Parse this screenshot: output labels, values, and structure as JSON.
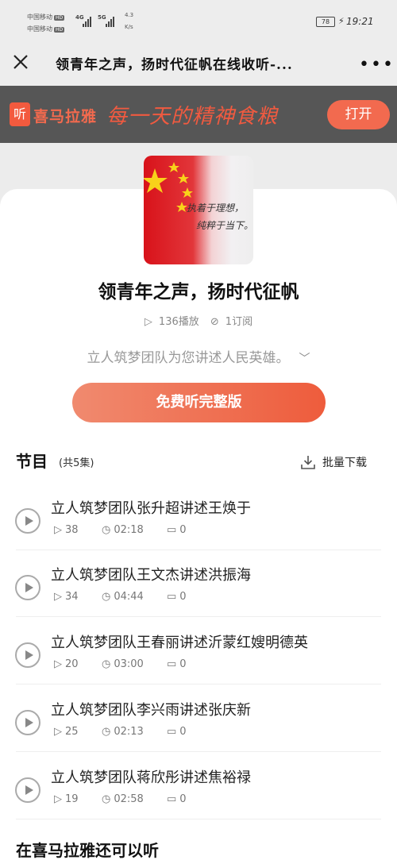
{
  "status_bar": {
    "carrier1": "中国移动",
    "carrier2": "中国移动",
    "hd": "HD",
    "net1": "4G",
    "net2": "5G",
    "speed_value": "4.3",
    "speed_unit": "K/s",
    "battery": "78",
    "time": "19:21"
  },
  "title_bar": {
    "title": "领青年之声，扬时代征帆在线收听-...",
    "close_icon": "close-icon",
    "more_icon": "more-icon"
  },
  "banner": {
    "logo_glyph": "听",
    "logo_text": "喜马拉雅",
    "slogan": "每一天的精神食粮",
    "open_label": "打开"
  },
  "album": {
    "cover_text_line1": "执着于理想，",
    "cover_text_line2": "纯粹于当下。",
    "title": "领青年之声，扬时代征帆",
    "plays": "136播放",
    "subscribers": "1订阅",
    "description": "立人筑梦团队为您讲述人民英雄。",
    "free_button": "免费听完整版"
  },
  "episodes_section": {
    "heading": "节目",
    "count": "(共5集)",
    "batch_download": "批量下载"
  },
  "episodes": [
    {
      "title": "立人筑梦团队张升超讲述王焕于",
      "plays": "38",
      "duration": "02:18",
      "comments": "0"
    },
    {
      "title": "立人筑梦团队王文杰讲述洪振海",
      "plays": "34",
      "duration": "04:44",
      "comments": "0"
    },
    {
      "title": "立人筑梦团队王春丽讲述沂蒙红嫂明德英",
      "plays": "20",
      "duration": "03:00",
      "comments": "0"
    },
    {
      "title": "立人筑梦团队李兴雨讲述张庆新",
      "plays": "25",
      "duration": "02:13",
      "comments": "0"
    },
    {
      "title": "立人筑梦团队蒋欣彤讲述焦裕禄",
      "plays": "19",
      "duration": "02:58",
      "comments": "0"
    }
  ],
  "more_section": {
    "heading": "在喜马拉雅还可以听"
  },
  "colors": {
    "accent": "#f26a4f",
    "banner_bg": "#565656"
  }
}
